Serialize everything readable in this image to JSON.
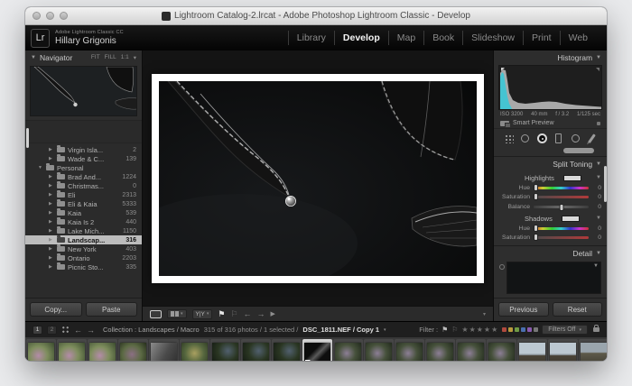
{
  "window": {
    "title": "Lightroom Catalog-2.lrcat - Adobe Photoshop Lightroom Classic - Develop"
  },
  "identity": {
    "logo": "Lr",
    "app_small": "Adobe Lightroom Classic CC",
    "user": "Hillary Grigonis"
  },
  "modules": {
    "items": [
      {
        "label": "Library",
        "cls": ""
      },
      {
        "label": "Develop",
        "cls": "active"
      },
      {
        "label": "Map",
        "cls": ""
      },
      {
        "label": "Book",
        "cls": ""
      },
      {
        "label": "Slideshow",
        "cls": ""
      },
      {
        "label": "Print",
        "cls": ""
      },
      {
        "label": "Web",
        "cls": ""
      }
    ]
  },
  "left": {
    "navigator": {
      "tri": "▼",
      "title": "Navigator",
      "fit": "FIT",
      "fill": "FILL",
      "ratio": "1:1",
      "caret": "▾"
    },
    "folders": [
      {
        "tri": "▶",
        "name": "Virgin Isla...",
        "count": "2",
        "cls": "d2"
      },
      {
        "tri": "▶",
        "name": "Wade & C...",
        "count": "139",
        "cls": "d2"
      },
      {
        "tri": "▼",
        "name": "Personal",
        "count": "",
        "cls": "d1"
      },
      {
        "tri": "▶",
        "name": "Brad And...",
        "count": "1224",
        "cls": "d2"
      },
      {
        "tri": "▶",
        "name": "Christmas...",
        "count": "0",
        "cls": "d2"
      },
      {
        "tri": "▶",
        "name": "Eli",
        "count": "2313",
        "cls": "d2"
      },
      {
        "tri": "▶",
        "name": "Eli & Kaia",
        "count": "5333",
        "cls": "d2"
      },
      {
        "tri": "▶",
        "name": "Kaia",
        "count": "539",
        "cls": "d2"
      },
      {
        "tri": "▶",
        "name": "Kaia Is 2",
        "count": "440",
        "cls": "d2"
      },
      {
        "tri": "▶",
        "name": "Lake Mich...",
        "count": "1150",
        "cls": "d2"
      },
      {
        "tri": "▶",
        "name": "Landscap...",
        "count": "316",
        "cls": "d2 sel"
      },
      {
        "tri": "▶",
        "name": "New York",
        "count": "403",
        "cls": "d2"
      },
      {
        "tri": "▶",
        "name": "Ontario",
        "count": "2203",
        "cls": "d2"
      },
      {
        "tri": "▶",
        "name": "Picnic Sto...",
        "count": "335",
        "cls": "d2"
      }
    ],
    "copy": "Copy...",
    "paste": "Paste"
  },
  "right": {
    "histogram": {
      "title": "Histogram",
      "tri": "▼",
      "exif": {
        "iso": "ISO 3200",
        "focal": "40 mm",
        "aperture": "f / 3.2",
        "shutter": "1/125 sec"
      },
      "smart_preview": "Smart Preview"
    },
    "split": {
      "title": "Split Toning",
      "tri": "▼",
      "highlights": "Highlights",
      "shadows": "Shadows",
      "hue": "Hue",
      "saturation": "Saturation",
      "balance": "Balance",
      "zero": "0",
      "swatch_tri": "▼"
    },
    "detail": {
      "title": "Detail",
      "tri": "▼",
      "box_tri": "▼"
    },
    "previous": "Previous",
    "reset": "Reset"
  },
  "toolbar": {
    "yy": "Y|Y",
    "caret": "▾",
    "flag": "⚑",
    "flag_o": "⚐",
    "back": "←",
    "fwd": "→",
    "play": "▶",
    "options": "▾"
  },
  "filmstrip": {
    "monitor1": "1",
    "monitor2": "2",
    "back": "←",
    "fwd": "→",
    "source": "Collection : Landscapes / Macro",
    "status": "315 of 316 photos / 1 selected /",
    "filename": "DSC_1811.NEF / Copy 1",
    "caret": "▾",
    "filter_label": "Filter :",
    "flag": "⚑",
    "flag_o": "⚐",
    "stars": [
      "★",
      "★",
      "★",
      "★",
      "★"
    ],
    "color_labels": [
      "#b04a3e",
      "#b99a3d",
      "#6f9a45",
      "#4a6fb0",
      "#8a5ab0",
      "#777777"
    ],
    "filters_off": "Filters Off",
    "filters_caret": "▾",
    "thumbs": [
      {
        "cls": "flower"
      },
      {
        "cls": "flower"
      },
      {
        "cls": "flower"
      },
      {
        "cls": "flowerdark bdgcell"
      },
      {
        "cls": "bwgray bdg"
      },
      {
        "cls": "greengold"
      },
      {
        "cls": "darkleaf"
      },
      {
        "cls": "darkleaf"
      },
      {
        "cls": "darkleaf bdg"
      },
      {
        "cls": "bwleaf selcell"
      },
      {
        "cls": "purpleleaf"
      },
      {
        "cls": "purpleleaf"
      },
      {
        "cls": "purpleleaf"
      },
      {
        "cls": "purpleleaf"
      },
      {
        "cls": "purpleleaf"
      },
      {
        "cls": "purpleleaf"
      },
      {
        "cls": "sky bdg"
      },
      {
        "cls": "sky bdg"
      },
      {
        "cls": "field bdg"
      }
    ]
  }
}
